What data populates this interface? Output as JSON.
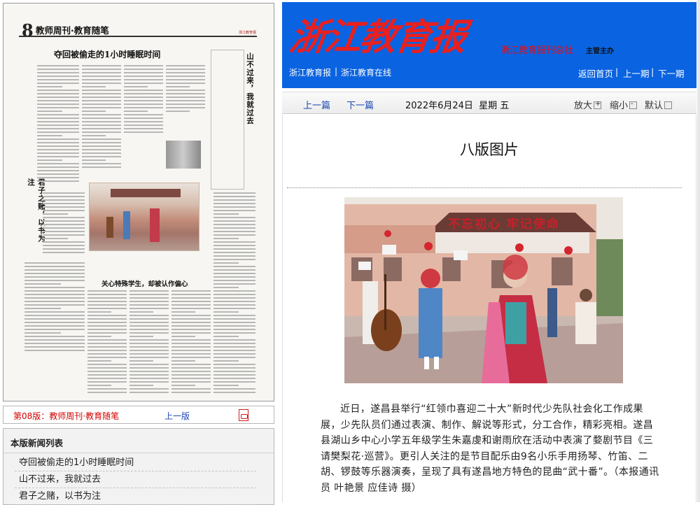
{
  "newspaper_page": {
    "page_number": "8",
    "section_title": "教师周刊·教育随笔",
    "headline_main": "夺回被偷走的1小时睡眠时间",
    "headline_side": "山不过来，我就过去",
    "headline_left_vertical": "君子之赌，以书为注",
    "headline_middle": "关心特殊学生，却被认作偏心",
    "photo_banner": "不忘初心 牢记使命",
    "logo_small": "浙江教育报"
  },
  "page_nav": {
    "current_page": "第08版：教师周刊·教育随笔",
    "prev_page": "上一版"
  },
  "news_list": {
    "title": "本版新闻列表",
    "items": [
      "夺回被偷走的1小时睡眠时间",
      "山不过来，我就过去",
      "君子之赌，以书为注"
    ]
  },
  "header": {
    "logo_text": "浙江教育报",
    "publisher": "浙江教育报刊总社",
    "sponsor": "主管主办",
    "site_links": [
      "浙江教育报",
      "浙江教育在线"
    ],
    "nav_links": [
      "返回首页",
      "上一期",
      "下一期"
    ]
  },
  "toolbar": {
    "prev_article": "上一篇",
    "next_article": "下一篇",
    "date": "2022年6月24日  星期 五",
    "zoom_in": "放大",
    "zoom_out": "缩小",
    "zoom_default": "默认"
  },
  "article": {
    "title": "八版图片",
    "photo_banner": "不忘初心 牢记使命",
    "body": "近日，遂昌县举行“红领巾喜迎二十大”新时代少先队社会化工作成果展，少先队员们通过表演、制作、解说等形式，分工合作，精彩亮相。遂昌县湖山乡中心小学五年级学生朱嘉虔和谢雨欣在活动中表演了婺剧节目《三请樊梨花·巡营》。更引人关注的是节目配乐由9名小乐手用扬琴、竹笛、二胡、锣鼓等乐器演奏，呈现了具有遂昌地方特色的昆曲“武十番”。（本报通讯员  叶艳景  应佳诗  摄）"
  },
  "colors": {
    "header_blue": "#0a63e1",
    "logo_red": "#e8201f",
    "link_blue": "#1c47b4",
    "current_red": "#d40000"
  }
}
